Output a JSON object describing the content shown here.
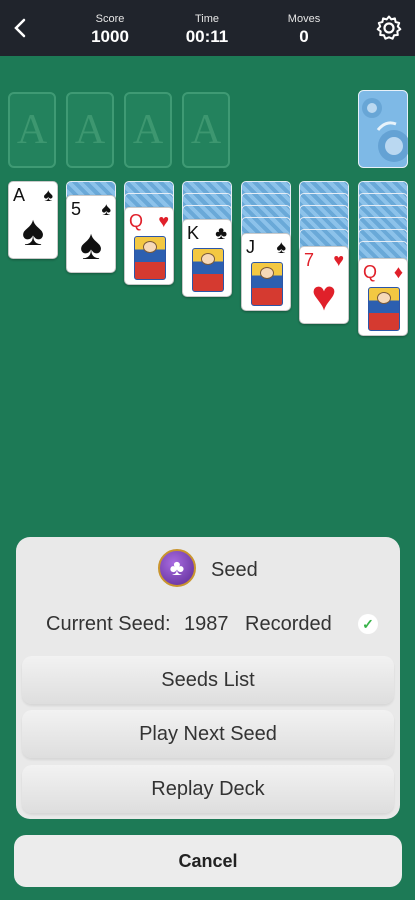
{
  "header": {
    "score": {
      "label": "Score",
      "value": "1000"
    },
    "time": {
      "label": "Time",
      "value": "00:11"
    },
    "moves": {
      "label": "Moves",
      "value": "0"
    }
  },
  "foundations": {
    "placeholder": "A"
  },
  "tableau": [
    {
      "rank": "A",
      "suit": "♠",
      "color": "black"
    },
    {
      "rank": "5",
      "suit": "♠",
      "color": "black"
    },
    {
      "rank": "Q",
      "suit": "♥",
      "color": "red"
    },
    {
      "rank": "K",
      "suit": "♣",
      "color": "black"
    },
    {
      "rank": "J",
      "suit": "♠",
      "color": "black"
    },
    {
      "rank": "7",
      "suit": "♥",
      "color": "red"
    },
    {
      "rank": "Q",
      "suit": "♦",
      "color": "red"
    }
  ],
  "dialog": {
    "icon": "club-icon",
    "title": "Seed",
    "seed_label": "Current Seed:",
    "seed_value": "1987",
    "seed_status": "Recorded",
    "buttons": {
      "seeds_list": "Seeds List",
      "play_next": "Play Next Seed",
      "replay": "Replay Deck"
    },
    "cancel": "Cancel"
  },
  "colors": {
    "felt": "#1d7a56",
    "header": "#20242c",
    "red_suit": "#e0202a"
  }
}
